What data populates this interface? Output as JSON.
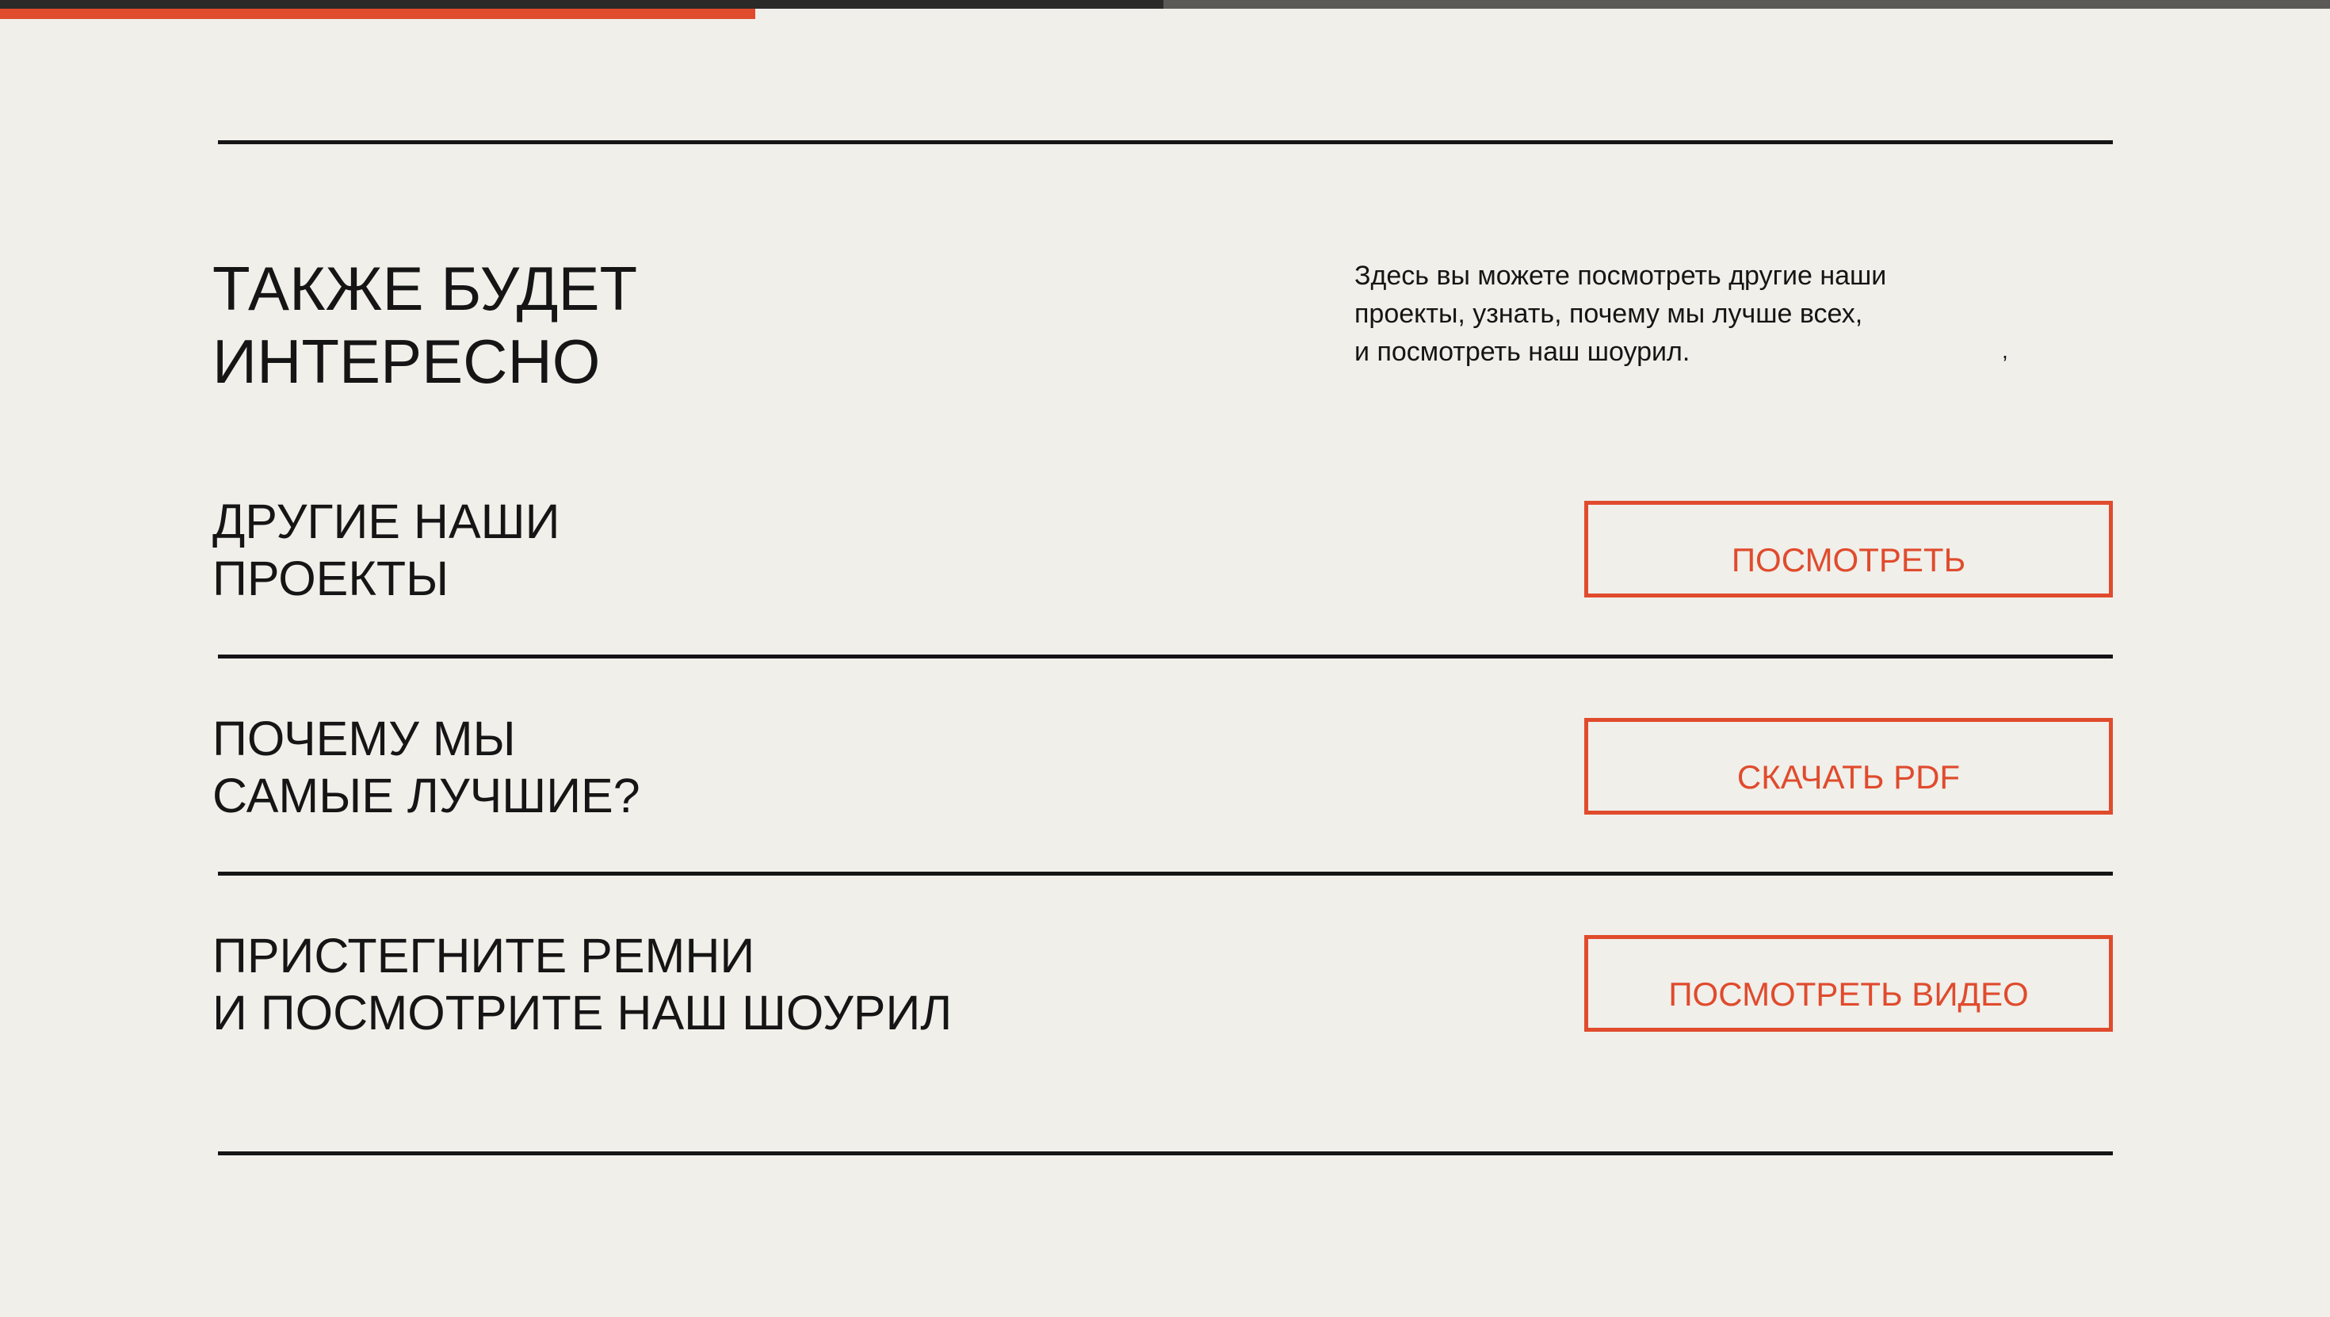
{
  "progress": {
    "fraction": 0.324
  },
  "hero": {
    "title": "ТАКЖЕ БУДЕТ\nИНТЕРЕСНО",
    "description": "Здесь вы можете посмотреть другие наши\nпроекты, узнать, почему мы лучше всех,\nи посмотреть наш шоурил.",
    "comma": ","
  },
  "rows": [
    {
      "title": "ДРУГИЕ НАШИ\nПРОЕКТЫ",
      "button": "ПОСМОТРЕТЬ"
    },
    {
      "title": "ПОЧЕМУ МЫ\nСАМЫЕ ЛУЧШИЕ?",
      "button": "СКАЧАТЬ PDF"
    },
    {
      "title": "ПРИСТЕГНИТЕ РЕМНИ\nИ ПОСМОТРИТЕ НАШ ШОУРИЛ",
      "button": "ПОСМОТРЕТЬ ВИДЕО"
    }
  ],
  "colors": {
    "background": "#f0efea",
    "text": "#151515",
    "accent": "#e04b2d",
    "progress_track": "#5b5a56",
    "progress_dark": "#2c2a29"
  }
}
